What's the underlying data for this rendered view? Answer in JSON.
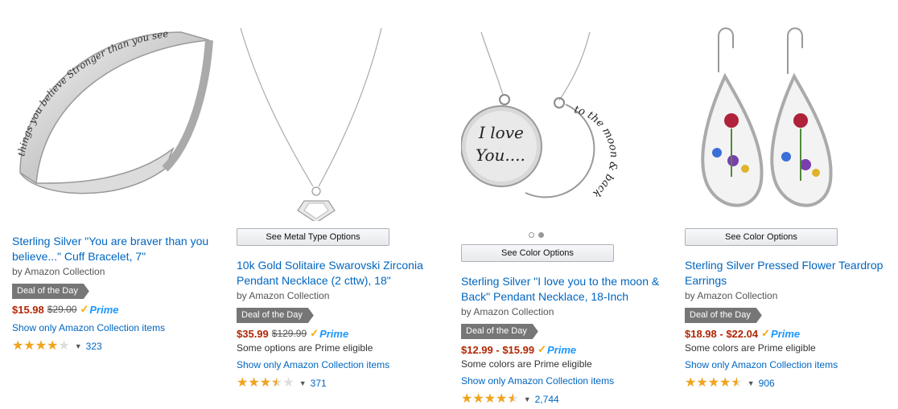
{
  "products": [
    {
      "title": "Sterling Silver \"You are braver than you believe...\" Cuff Bracelet, 7\"",
      "by": "by Amazon Collection",
      "deal": "Deal of the Day",
      "price": "$15.98",
      "list_price": "$29.00",
      "prime": "Prime",
      "show_only": "Show only Amazon Collection items",
      "rating": 4.0,
      "review_count": "323",
      "image_text": "things you believe Stronger than you seem and"
    },
    {
      "option_button": "See Metal Type Options",
      "title": "10k Gold Solitaire Swarovski Zirconia Pendant Necklace (2 cttw), 18\"",
      "by": "by Amazon Collection",
      "deal": "Deal of the Day",
      "price": "$35.99",
      "list_price": "$129.99",
      "prime": "Prime",
      "prime_note": "Some options are Prime eligible",
      "show_only": "Show only Amazon Collection items",
      "rating": 3.5,
      "review_count": "371"
    },
    {
      "option_button": "See Color Options",
      "title": "Sterling Silver \"I love you to the moon & Back\" Pendant Necklace, 18-Inch",
      "by": "by Amazon Collection",
      "deal": "Deal of the Day",
      "price": "$12.99 - $15.99",
      "prime": "Prime",
      "prime_note": "Some colors are Prime eligible",
      "show_only": "Show only Amazon Collection items",
      "rating": 4.5,
      "review_count": "2,744",
      "image_text": {
        "disc_line1": "I love",
        "disc_line2": "You....",
        "moon": "to the moon & back"
      }
    },
    {
      "option_button": "See Color Options",
      "title": "Sterling Silver Pressed Flower Teardrop Earrings",
      "by": "by Amazon Collection",
      "deal": "Deal of the Day",
      "price": "$18.98 - $22.04",
      "prime": "Prime",
      "prime_note": "Some colors are Prime eligible",
      "show_only": "Show only Amazon Collection items",
      "rating": 4.5,
      "review_count": "906"
    }
  ],
  "colors": {
    "link": "#0066c0",
    "price": "#b12704",
    "star": "#f0a41d",
    "deal_badge": "#767676",
    "prime_blue": "#1a98ff",
    "prime_check": "#f7a600"
  },
  "icons": {
    "prime": "prime-check-icon",
    "rating_caret": "caret-down-icon",
    "stars": "star-icon"
  }
}
